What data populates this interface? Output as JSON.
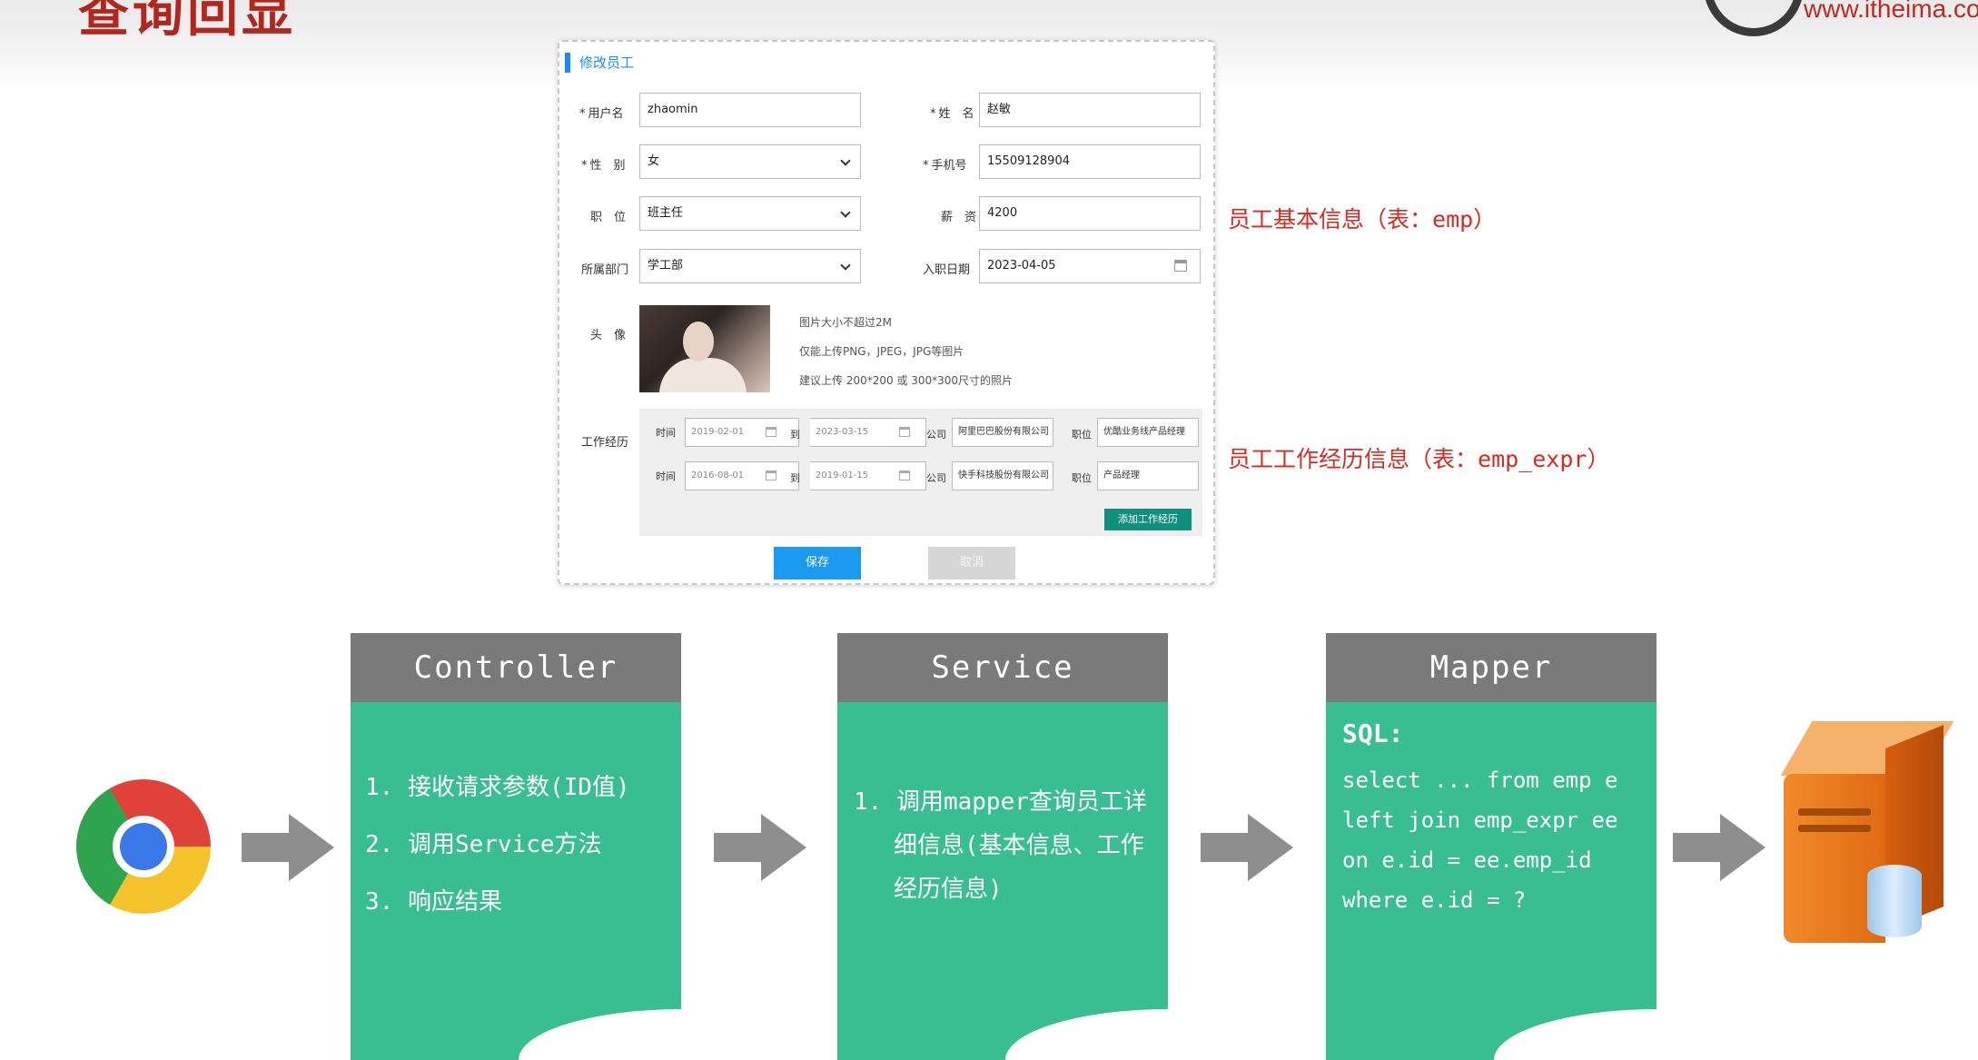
{
  "slide": {
    "title": "查询回显",
    "site_url": "www.itheima.com"
  },
  "form": {
    "title": "修改员工",
    "fields": {
      "username": {
        "label": "用户名",
        "value": "zhaomin"
      },
      "name": {
        "label": "姓　名",
        "value": "赵敏"
      },
      "gender": {
        "label": "性　别",
        "value": "女"
      },
      "phone": {
        "label": "手机号",
        "value": "15509128904"
      },
      "job": {
        "label": "职　位",
        "value": "班主任"
      },
      "salary": {
        "label": "薪　资",
        "value": "4200"
      },
      "dept": {
        "label": "所属部门",
        "value": "学工部"
      },
      "entry_date": {
        "label": "入职日期",
        "value": "2023-04-05"
      },
      "avatar": {
        "label": "头　像"
      }
    },
    "avatar_hints": [
      "图片大小不超过2M",
      "仅能上传PNG，JPEG，JPG等图片",
      "建议上传 200*200 或 300*300尺寸的照片"
    ],
    "work_exp": {
      "label": "工作经历",
      "time_label": "时间",
      "to_label": "到",
      "company_label": "公司",
      "position_label": "职位",
      "rows": [
        {
          "start": "2019-02-01",
          "end": "2023-03-15",
          "company": "阿里巴巴股份有限公司",
          "position": "优酷业务线产品经理"
        },
        {
          "start": "2016-08-01",
          "end": "2019-01-15",
          "company": "快手科技股份有限公司",
          "position": "产品经理"
        }
      ],
      "add_button": "添加工作经历"
    },
    "save_button": "保存",
    "cancel_button": "取消"
  },
  "annotations": {
    "basic_info_prefix": "员工基本信息（表：",
    "basic_info_table": "emp",
    "basic_info_suffix": "）",
    "exp_info_prefix": "员工工作经历信息（表：",
    "exp_info_table": "emp_expr",
    "exp_info_suffix": "）"
  },
  "diagram": {
    "controller": {
      "title": "Controller",
      "steps": [
        "1. 接收请求参数(ID值)",
        "2. 调用Service方法",
        "3. 响应结果"
      ]
    },
    "service": {
      "title": "Service",
      "steps": [
        "1. 调用mapper查询员工详",
        "细信息(基本信息、工作",
        "经历信息)"
      ]
    },
    "mapper": {
      "title": "Mapper",
      "sql_label": "SQL:",
      "sql_lines": [
        "select ... from emp e",
        "left join emp_expr ee",
        "on e.id = ee.emp_id",
        "where e.id = ?"
      ]
    }
  },
  "icons": {
    "browser": "chrome-icon",
    "database_server": "server-icon",
    "arrow": "arrow-right-icon"
  }
}
